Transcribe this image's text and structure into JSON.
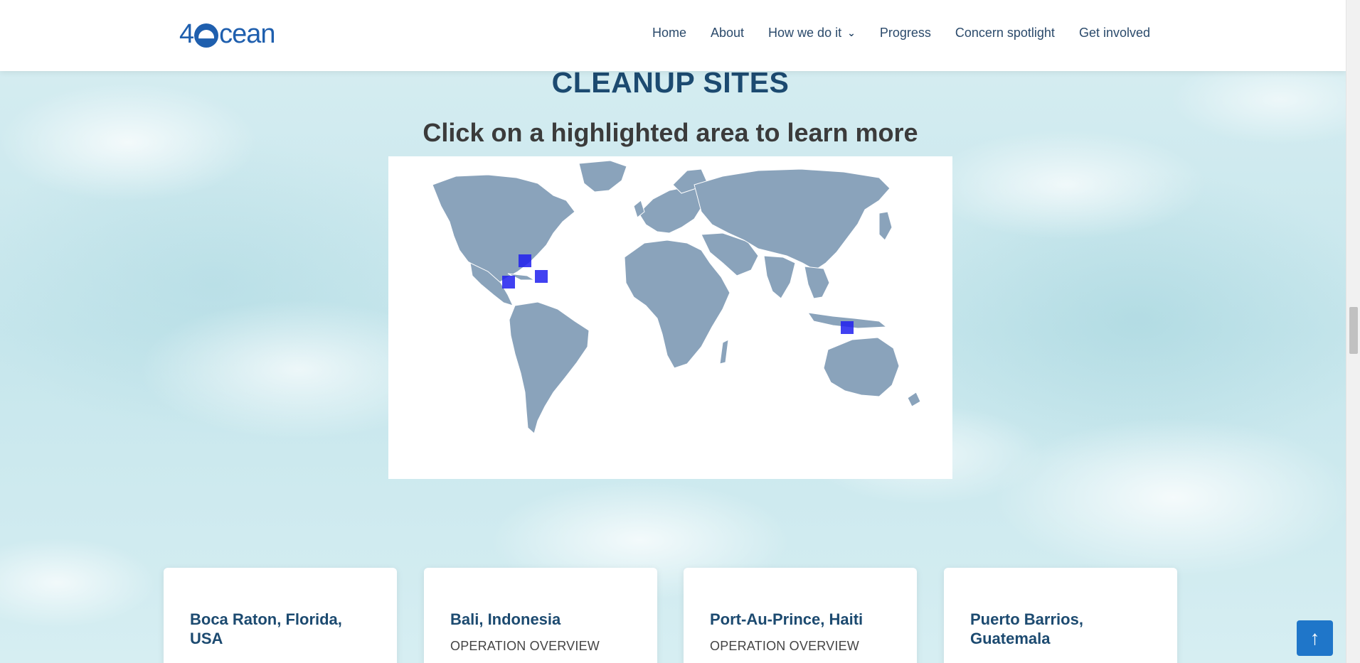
{
  "brand": {
    "logo_prefix": "4",
    "logo_suffix": "cean",
    "color": "#1f5fae"
  },
  "nav": {
    "items": [
      {
        "label": "Home"
      },
      {
        "label": "About"
      },
      {
        "label": "How we do it",
        "has_dropdown": true
      },
      {
        "label": "Progress"
      },
      {
        "label": "Concern spotlight"
      },
      {
        "label": "Get involved"
      }
    ]
  },
  "section": {
    "title": "CLEANUP SITES",
    "subtitle": "Click on a highlighted area to learn more"
  },
  "map": {
    "land_color": "#8aa3bb",
    "marker_color": "#2020ee",
    "markers": [
      {
        "name": "marker-florida"
      },
      {
        "name": "marker-haiti"
      },
      {
        "name": "marker-guatemala"
      },
      {
        "name": "marker-bali"
      }
    ]
  },
  "cards": [
    {
      "title": "Boca Raton, Florida, USA",
      "subtitle": ""
    },
    {
      "title": "Bali, Indonesia",
      "subtitle": "OPERATION OVERVIEW"
    },
    {
      "title": "Port-Au-Prince, Haiti",
      "subtitle": "OPERATION OVERVIEW"
    },
    {
      "title": "Puerto Barrios, Guatemala",
      "subtitle": ""
    }
  ],
  "back_to_top": {
    "icon": "arrow-up-icon",
    "color": "#1f76c9"
  }
}
